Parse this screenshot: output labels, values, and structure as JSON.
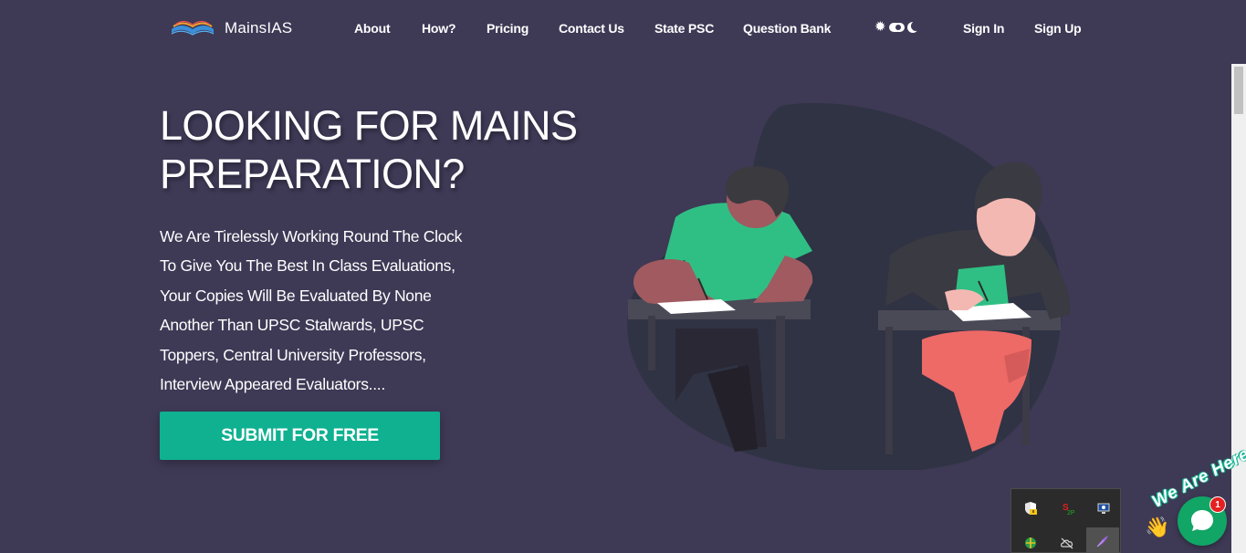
{
  "brand": {
    "name": "MainsIAS",
    "logo_icon": "book-logo-icon"
  },
  "nav": {
    "links": [
      "About",
      "How?",
      "Pricing",
      "Contact Us",
      "State PSC",
      "Question Bank"
    ],
    "sign_in": "Sign In",
    "sign_up": "Sign Up",
    "theme_toggle": {
      "sun_icon": "sun-icon",
      "moon_icon": "moon-icon",
      "mode": "dark"
    }
  },
  "hero": {
    "title_line1": "LOOKING FOR MAINS",
    "title_line2": "PREPARATION?",
    "text_lines": [
      "We Are Tirelessly Working Round The Clock",
      "To Give You The Best In Class Evaluations,",
      "Your Copies Will Be Evaluated By None",
      "Another Than UPSC Stalwards, UPSC",
      "Toppers, Central University Professors,",
      "Interview Appeared Evaluators...."
    ],
    "cta": "SUBMIT FOR FREE"
  },
  "chat": {
    "tagline": "We Are Here!",
    "badge": "1",
    "wave_icon": "waving-hand-icon",
    "chat_icon": "chat-bubble-icon"
  },
  "tray": {
    "icons": [
      "shield-warning-icon",
      "s2p-icon",
      "monitor-icon",
      "network-icon",
      "cloud-offline-icon",
      "feather-icon"
    ]
  },
  "colors": {
    "background": "#3e3955",
    "accent": "#0fb190",
    "text": "#ffffff",
    "chat_green": "#11a566",
    "badge_red": "#e62020"
  }
}
